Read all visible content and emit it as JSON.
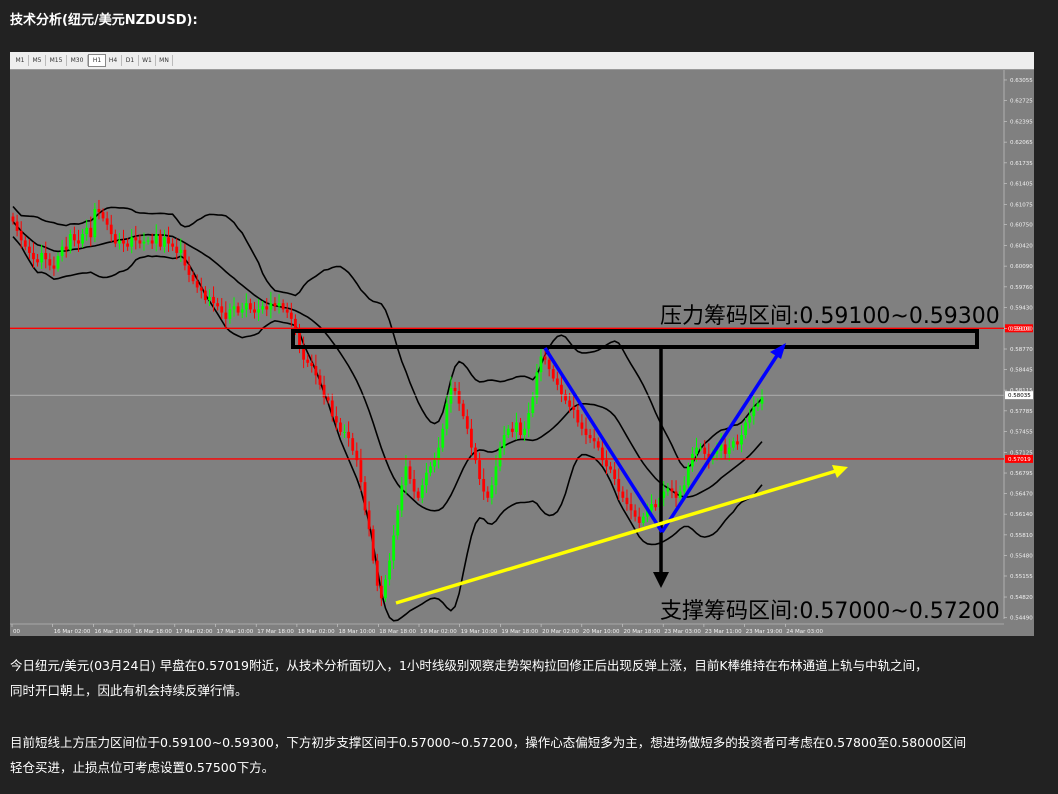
{
  "heading": "技术分析(纽元/美元NZDUSD):",
  "toolbar": {
    "timeframes": [
      "M1",
      "M5",
      "M15",
      "M30",
      "H1",
      "H4",
      "D1",
      "W1",
      "MN"
    ],
    "active": "H1"
  },
  "colors": {
    "page_bg": "#222222",
    "chart_bg": "#808080",
    "bull_candle": "#00ff00",
    "bear_candle": "#ff0000",
    "level_line": "#ff0000",
    "bollinger": "#000000",
    "trend_arrow": "#0000ff",
    "support_trendline": "#ffff00"
  },
  "chart_data": {
    "type": "candlestick",
    "symbol": "NZDUSD",
    "timeframe": "H1",
    "ylim": [
      0.5447,
      0.6315
    ],
    "y_ticks": [
      "0.63055",
      "0.62725",
      "0.62395",
      "0.62065",
      "0.61735",
      "0.61405",
      "0.61075",
      "0.60750",
      "0.60420",
      "0.60090",
      "0.59760",
      "0.59430",
      "0.59100",
      "0.58770",
      "0.58445",
      "0.58115",
      "0.57785",
      "0.57455",
      "0.57125",
      "0.56795",
      "0.56470",
      "0.56140",
      "0.55810",
      "0.55480",
      "0.55155",
      "0.54820",
      "0.54490"
    ],
    "x_ticks": [
      "00",
      "16 Mar 02:00",
      "16 Mar 10:00",
      "16 Mar 18:00",
      "17 Mar 02:00",
      "17 Mar 10:00",
      "17 Mar 18:00",
      "18 Mar 02:00",
      "18 Mar 10:00",
      "18 Mar 18:00",
      "19 Mar 02:00",
      "19 Mar 10:00",
      "19 Mar 18:00",
      "20 Mar 02:00",
      "20 Mar 10:00",
      "20 Mar 18:00",
      "23 Mar 03:00",
      "23 Mar 11:00",
      "23 Mar 19:00",
      "24 Mar 03:00"
    ],
    "price_labels": {
      "resistance_level": "0.59100",
      "current_price": "0.58035",
      "support_level": "0.57019"
    },
    "resistance_line": 0.591,
    "support_line": 0.5702,
    "current_price": 0.58035,
    "closes": [
      0.608,
      0.6065,
      0.605,
      0.604,
      0.603,
      0.602,
      0.6015,
      0.603,
      0.602,
      0.601,
      0.6005,
      0.6025,
      0.604,
      0.6035,
      0.606,
      0.605,
      0.6045,
      0.606,
      0.607,
      0.6055,
      0.61,
      0.6095,
      0.6085,
      0.6075,
      0.606,
      0.6045,
      0.605,
      0.6045,
      0.604,
      0.6055,
      0.605,
      0.6045,
      0.6048,
      0.605,
      0.6045,
      0.606,
      0.604,
      0.6055,
      0.6045,
      0.604,
      0.603,
      0.6035,
      0.601,
      0.5995,
      0.5985,
      0.5975,
      0.597,
      0.5955,
      0.596,
      0.595,
      0.5945,
      0.5935,
      0.5925,
      0.594,
      0.5945,
      0.5935,
      0.594,
      0.595,
      0.594,
      0.5935,
      0.594,
      0.5945,
      0.594,
      0.595,
      0.5945,
      0.595,
      0.594,
      0.5935,
      0.5925,
      0.5905,
      0.588,
      0.586,
      0.5855,
      0.585,
      0.5835,
      0.582,
      0.58,
      0.5795,
      0.577,
      0.576,
      0.5745,
      0.5745,
      0.5735,
      0.5715,
      0.57,
      0.5665,
      0.562,
      0.559,
      0.554,
      0.55,
      0.548,
      0.551,
      0.554,
      0.558,
      0.562,
      0.566,
      0.569,
      0.567,
      0.565,
      0.564,
      0.566,
      0.568,
      0.569,
      0.57,
      0.572,
      0.575,
      0.579,
      0.5815,
      0.581,
      0.579,
      0.577,
      0.575,
      0.572,
      0.57,
      0.567,
      0.565,
      0.564,
      0.566,
      0.569,
      0.572,
      0.574,
      0.575,
      0.5745,
      0.576,
      0.574,
      0.575,
      0.5775,
      0.58,
      0.584,
      0.5865,
      0.586,
      0.5845,
      0.583,
      0.582,
      0.5805,
      0.5795,
      0.5785,
      0.578,
      0.576,
      0.575,
      0.574,
      0.5735,
      0.573,
      0.572,
      0.57,
      0.569,
      0.5685,
      0.567,
      0.565,
      0.564,
      0.563,
      0.562,
      0.561,
      0.56,
      0.561,
      0.562,
      0.563,
      0.5625,
      0.564,
      0.565,
      0.5655,
      0.565,
      0.564,
      0.565,
      0.566,
      0.569,
      0.571,
      0.572,
      0.572,
      0.571,
      0.57,
      0.571,
      0.5715,
      0.5725,
      0.571,
      0.572,
      0.573,
      0.5725,
      0.574,
      0.576,
      0.577,
      0.5785,
      0.579,
      0.58
    ],
    "annotations": {
      "resistance_zone": "压力筹码区间:0.59100~0.59300",
      "support_zone": "支撑筹码区间:0.57000~0.57200"
    }
  },
  "paragraphs": {
    "p1_line1": "今日纽元/美元(03月24日) 早盘在0.57019附近，从技术分析面切入，1小时线级别观察走势架构拉回修正后出现反弹上涨，目前K棒维持在布林通道上轨与中轨之间，",
    "p1_line2": "同时开口朝上，因此有机会持续反弹行情。",
    "p2_line1": "目前短线上方压力区间位于0.59100~0.59300，下方初步支撑区间于0.57000~0.57200，操作心态偏短多为主，想进场做短多的投资者可考虑在0.57800至0.58000区间",
    "p2_line2": "轻仓买进，止损点位可考虑设置0.57500下方。"
  }
}
